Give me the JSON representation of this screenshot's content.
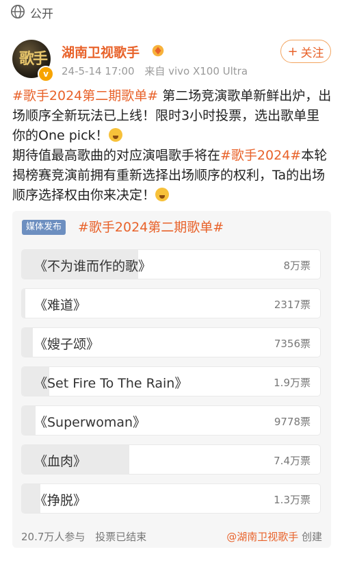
{
  "topbar": {
    "visibility_label": "公开"
  },
  "author": {
    "name": "湖南卫视歌手",
    "timestamp": "24-5-14 17:00",
    "source": "来自 vivo X100 Ultra",
    "follow_label": "关注",
    "avatar_text": "歌手"
  },
  "post": {
    "line1_tag": "#歌手2024第二期歌单#",
    "line1_text": " 第二场竞演歌单新鲜出炉，出场顺序全新玩法已上线！限时3小时投票，选出歌单里你的One pick！",
    "line2_text": "期待值最高歌曲的对应演唱歌手将在",
    "line2_tag": "#歌手2024#",
    "line2_text_after": "本轮揭榜赛竞演前拥有重新选择出场顺序的权利，Ta的出场顺序选择权由你来决定！"
  },
  "poll": {
    "media_tag": "媒体发布",
    "title": "#歌手2024第二期歌单#",
    "options": [
      {
        "label": "《不为谁而作的歌》",
        "votes": "8万票",
        "share": 0.39
      },
      {
        "label": "《难道》",
        "votes": "2317票",
        "share": 0.011
      },
      {
        "label": "《嫂子颂》",
        "votes": "7356票",
        "share": 0.036
      },
      {
        "label": "《Set Fire To The Rain》",
        "votes": "1.9万票",
        "share": 0.092
      },
      {
        "label": "《Superwoman》",
        "votes": "9778票",
        "share": 0.047
      },
      {
        "label": "《血肉》",
        "votes": "7.4万票",
        "share": 0.36
      },
      {
        "label": "《挣脱》",
        "votes": "1.3万票",
        "share": 0.063
      }
    ],
    "participants": "20.7万人参与",
    "status": "投票已结束",
    "creator_link": "@湖南卫视歌手",
    "creator_suffix": "创建"
  },
  "colors": {
    "accent": "#e8622a",
    "media_tag": "#6d8fc0",
    "bar_fill": "#eaeaea"
  }
}
